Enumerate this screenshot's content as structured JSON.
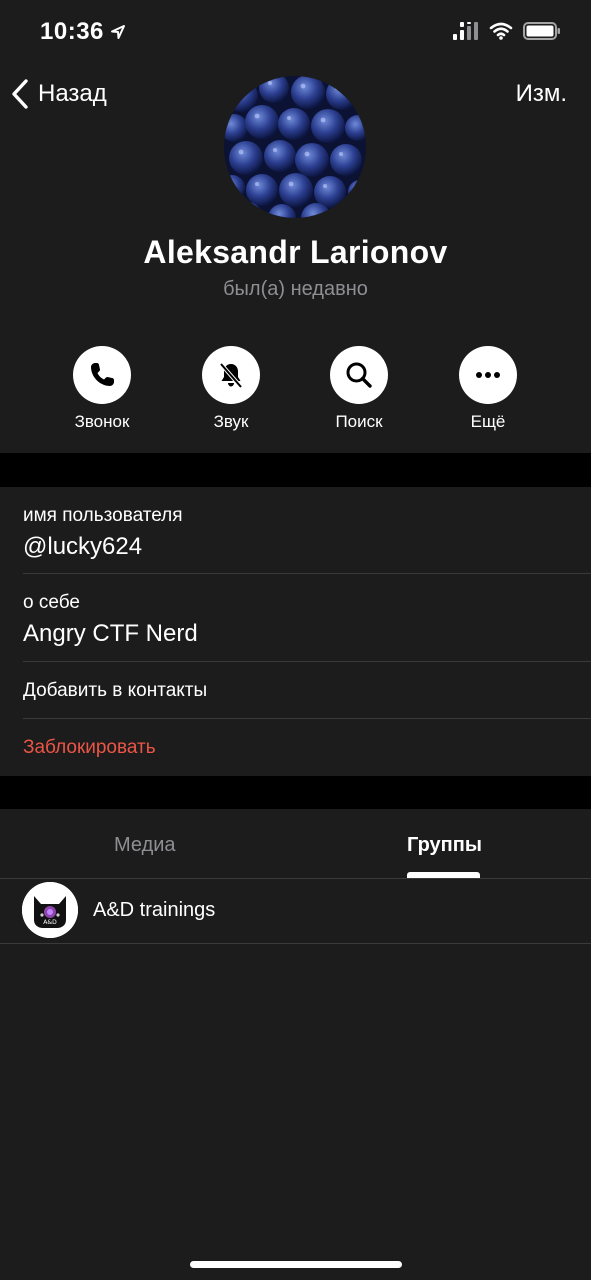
{
  "status_bar": {
    "time": "10:36",
    "icons": [
      "location-arrow-icon",
      "cellular-signal-icon",
      "wifi-icon",
      "battery-icon"
    ]
  },
  "nav": {
    "back_label": "Назад",
    "edit_label": "Изм."
  },
  "profile": {
    "name": "Aleksandr Larionov",
    "status": "был(а) недавно",
    "avatar": "blueberries-avatar"
  },
  "actions": [
    {
      "label": "Звонок",
      "icon": "phone-icon"
    },
    {
      "label": "Звук",
      "icon": "bell-muted-icon"
    },
    {
      "label": "Поиск",
      "icon": "search-icon"
    },
    {
      "label": "Ещё",
      "icon": "more-dots-icon"
    }
  ],
  "info": {
    "username_label": "имя пользователя",
    "username_value": "@lucky624",
    "bio_label": "о себе",
    "bio_value": "Angry CTF Nerd",
    "add_contact_label": "Добавить в контакты",
    "block_label": "Заблокировать"
  },
  "tabs": {
    "media_label": "Медиа",
    "groups_label": "Группы",
    "active": "groups"
  },
  "groups": [
    {
      "name": "A&D trainings",
      "avatar_text": "A&D"
    }
  ],
  "colors": {
    "background": "#1c1c1d",
    "secondary_text": "#8e8e93",
    "danger": "#eb5545",
    "separator": "#3a3a3c"
  }
}
